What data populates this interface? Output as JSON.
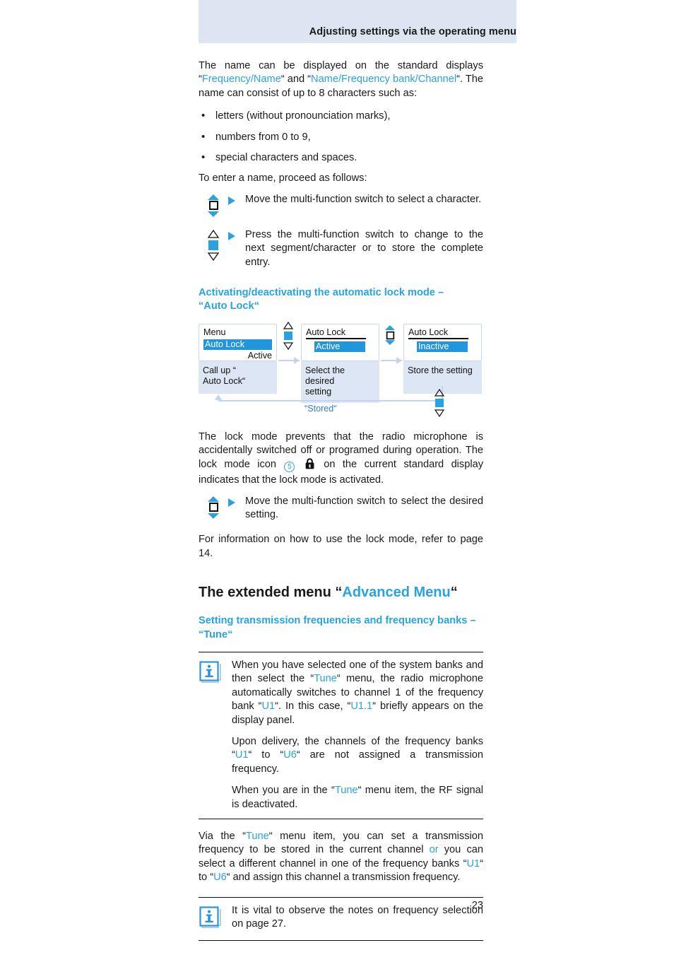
{
  "header": {
    "title": "Adjusting settings via the operating menu"
  },
  "intro": {
    "line1_a": "The name can be displayed on the standard displays “",
    "link1": "Frequency/Name",
    "line1_b": "“ and “",
    "link2": "Name/Frequency bank/Channel",
    "line1_c": "“. The name can consist of up to 8 characters such as:",
    "bullets": [
      "letters (without pronounciation marks),",
      "numbers from 0 to 9,",
      "special characters and spaces."
    ],
    "proceed": "To enter a name, proceed as follows:"
  },
  "steps": [
    {
      "switch": "mfs-move",
      "marker": "play-triangle-icon",
      "text": "Move the multi-function switch to select a character."
    },
    {
      "switch": "mfs-press",
      "marker": "play-triangle-icon",
      "text": "Press the multi-function switch to change to the next segment/character or to store the complete entry."
    }
  ],
  "autolock": {
    "heading_line1": "Activating/deactivating the automatic lock mode –",
    "heading_line2": "“Auto Lock“",
    "diagram": {
      "steps": [
        {
          "display": {
            "line1": "Menu",
            "line2": "Auto Lock",
            "line3": "Active"
          },
          "caption_line1": "Call up “",
          "caption_line2": "Auto Lock“"
        },
        {
          "display": {
            "line1": "Auto Lock",
            "line2": "Active"
          },
          "caption_line1": "Select the desired",
          "caption_line2": "setting"
        },
        {
          "display": {
            "line1": "Auto Lock",
            "line2": "Inactive"
          },
          "caption_line1": "Store the setting",
          "caption_line2": ""
        }
      ],
      "connector1_switch": "mfs-press",
      "connector2_switch": "mfs-move",
      "return_switch": "mfs-press",
      "return_label": "“Stored“"
    }
  },
  "lockmode": {
    "p1_a": "The lock mode prevents that the radio microphone is accidentally switched off or programed during operation. The lock mode icon",
    "circle_number": "5",
    "lock_icon": "padlock-icon",
    "p1_b": "on the current standard display indicates that the lock mode is activated.",
    "step": {
      "switch": "mfs-move",
      "text": "Move the multi-function switch to select the desired setting."
    },
    "p2": "For information on how to use the lock mode, refer to page 14."
  },
  "advanced": {
    "heading_a": "The extended menu “",
    "heading_link": "Advanced Menu",
    "heading_b": "“",
    "sub_line1": "Setting transmission frequencies and frequency banks –",
    "sub_line2": "“Tune“",
    "note1": {
      "icon": "info-icon",
      "p1_a": "When you have selected one of the system banks and then select the “",
      "p1_link1": "Tune",
      "p1_b": "“ menu, the radio microphone automatically switches to channel 1 of the frequency bank “",
      "p1_link2": "U1",
      "p1_c": "“. In this case, “",
      "p1_link3": "U1.1",
      "p1_d": "“ briefly appears on the display panel.",
      "p2_a": "Upon delivery, the channels of the frequency banks “",
      "p2_link1": "U1",
      "p2_b": "“ to “",
      "p2_link2": "U6",
      "p2_c": "“ are not assigned a transmission frequency.",
      "p3_a": "When you are in the “",
      "p3_link1": "Tune",
      "p3_b": "“ menu item, the RF signal is deactivated."
    },
    "via_p": {
      "a": "Via the “",
      "link1": "Tune",
      "b": "“ menu item, you can set a transmission frequency to be stored in the current channel ",
      "or": "or",
      "c": " you can select a different channel in one of the frequency banks “",
      "link2": "U1",
      "d": "“ to “",
      "link3": "U6",
      "e": "“ and assign this channel a transmission frequency."
    },
    "note2": {
      "icon": "info-icon",
      "text": "It is vital to observe the notes on frequency selection on page 27."
    }
  },
  "footer": {
    "page_number": "23"
  },
  "colors": {
    "accent": "#29a3e0",
    "header_band": "#dde4f2",
    "highlight": "#2196dc",
    "caption_bg": "#dce6f4",
    "connector": "#c3d5ee"
  }
}
